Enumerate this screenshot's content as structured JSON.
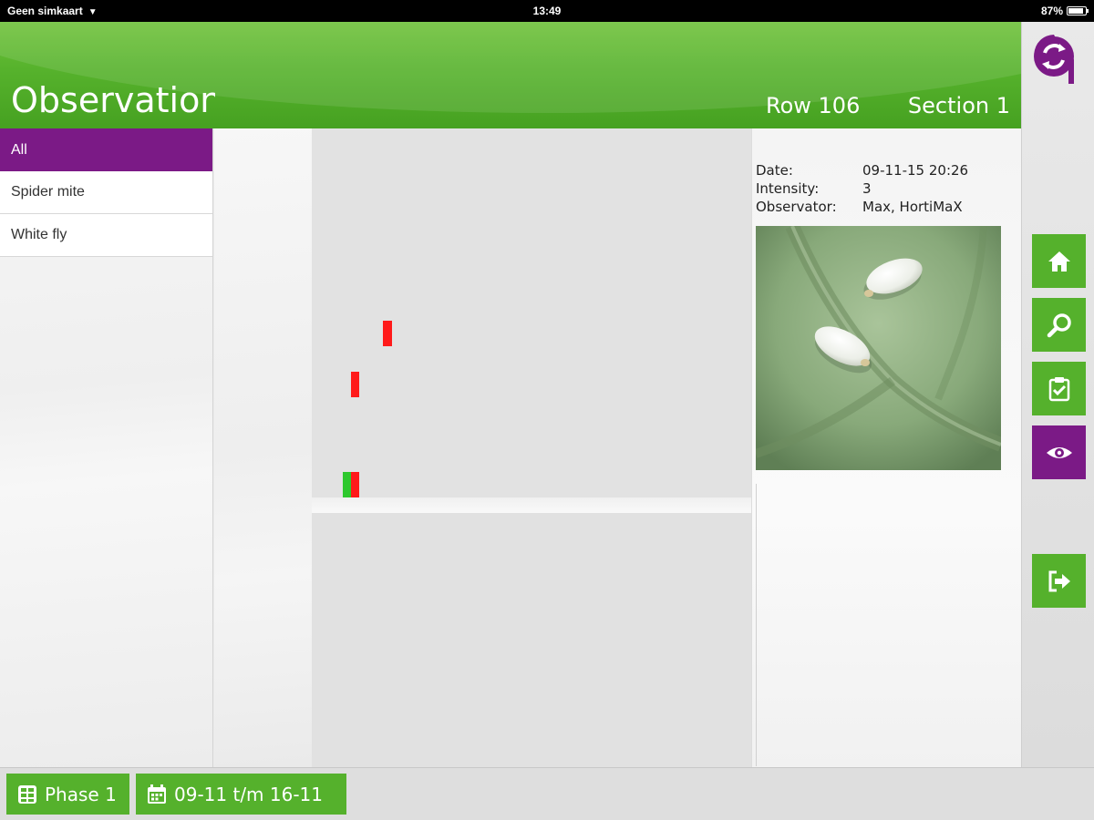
{
  "status_bar": {
    "carrier": "Geen simkaart",
    "time": "13:49",
    "battery": "87%"
  },
  "header": {
    "title": "Observation",
    "row": "Row 106",
    "section": "Section 1"
  },
  "categories": [
    {
      "label": "All",
      "selected": true
    },
    {
      "label": "Spider mite",
      "selected": false
    },
    {
      "label": "White fly",
      "selected": false
    }
  ],
  "detail": {
    "date_label": "Date:",
    "date_value": "09-11-15 20:26",
    "intensity_label": "Intensity:",
    "intensity_value": "3",
    "observator_label": "Observator:",
    "observator_value": "Max, HortiMaX"
  },
  "nav": {
    "icons": [
      "home-icon",
      "search-icon",
      "checklist-icon",
      "eye-icon",
      "logout-icon"
    ],
    "active": "eye-icon"
  },
  "footer": {
    "phase_label": "Phase 1",
    "date_range_label": "09-11 t/m 16-11"
  },
  "colors": {
    "green": "#55b12c",
    "purple": "#7b1a86",
    "marker_red": "#ff1a1a",
    "marker_green": "#2ec82e"
  }
}
